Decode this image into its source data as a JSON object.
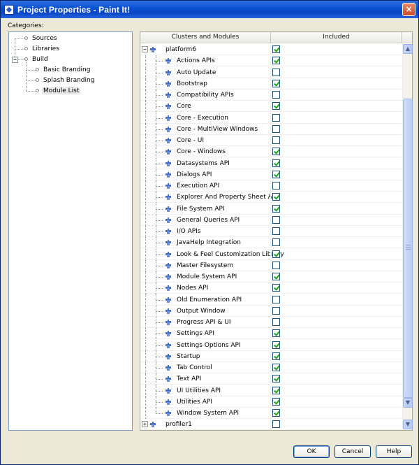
{
  "window": {
    "title": "Project Properties - Paint It!",
    "close_glyph": "×"
  },
  "categories": {
    "label": "Categories:",
    "items": [
      {
        "label": "Sources",
        "indent": 0
      },
      {
        "label": "Libraries",
        "indent": 0
      },
      {
        "label": "Build",
        "indent": 0,
        "expanded": true
      },
      {
        "label": "Basic Branding",
        "indent": 1
      },
      {
        "label": "Splash Branding",
        "indent": 1
      },
      {
        "label": "Module List",
        "indent": 1,
        "selected": true
      }
    ]
  },
  "modules_table": {
    "columns": [
      "Clusters and Modules",
      "Included"
    ],
    "rows": [
      {
        "name": "platform6",
        "cluster": true,
        "expanded": true,
        "included": true
      },
      {
        "name": "Actions APIs",
        "included": true
      },
      {
        "name": "Auto Update",
        "included": false
      },
      {
        "name": "Bootstrap",
        "included": true
      },
      {
        "name": "Compatibility APIs",
        "included": false
      },
      {
        "name": "Core",
        "included": true
      },
      {
        "name": "Core - Execution",
        "included": false
      },
      {
        "name": "Core - MultiView Windows",
        "included": false
      },
      {
        "name": "Core - UI",
        "included": false
      },
      {
        "name": "Core - Windows",
        "included": true
      },
      {
        "name": "Datasystems API",
        "included": true
      },
      {
        "name": "Dialogs API",
        "included": true
      },
      {
        "name": "Execution API",
        "included": false
      },
      {
        "name": "Explorer And Property Sheet API",
        "included": true
      },
      {
        "name": "File System API",
        "included": true
      },
      {
        "name": "General Queries API",
        "included": false
      },
      {
        "name": "I/O APIs",
        "included": false
      },
      {
        "name": "JavaHelp Integration",
        "included": false
      },
      {
        "name": "Look & Feel Customization Library",
        "included": true
      },
      {
        "name": "Master Filesystem",
        "included": false
      },
      {
        "name": "Module System API",
        "included": true
      },
      {
        "name": "Nodes API",
        "included": true
      },
      {
        "name": "Old Enumeration API",
        "included": false
      },
      {
        "name": "Output Window",
        "included": false
      },
      {
        "name": "Progress API & UI",
        "included": false
      },
      {
        "name": "Settings API",
        "included": true
      },
      {
        "name": "Settings Options API",
        "included": true
      },
      {
        "name": "Startup",
        "included": true
      },
      {
        "name": "Tab Control",
        "included": true
      },
      {
        "name": "Text API",
        "included": true
      },
      {
        "name": "UI Utilities API",
        "included": true
      },
      {
        "name": "Utilities API",
        "included": true
      },
      {
        "name": "Window System API",
        "included": true
      },
      {
        "name": "profiler1",
        "cluster": true,
        "expanded": false,
        "included": false
      }
    ]
  },
  "buttons": {
    "ok": "OK",
    "cancel": "Cancel",
    "help": "Help"
  },
  "colors": {
    "titlebar": "#0a4fd0",
    "check": "#21a121",
    "selection": "#e7e7e7"
  }
}
